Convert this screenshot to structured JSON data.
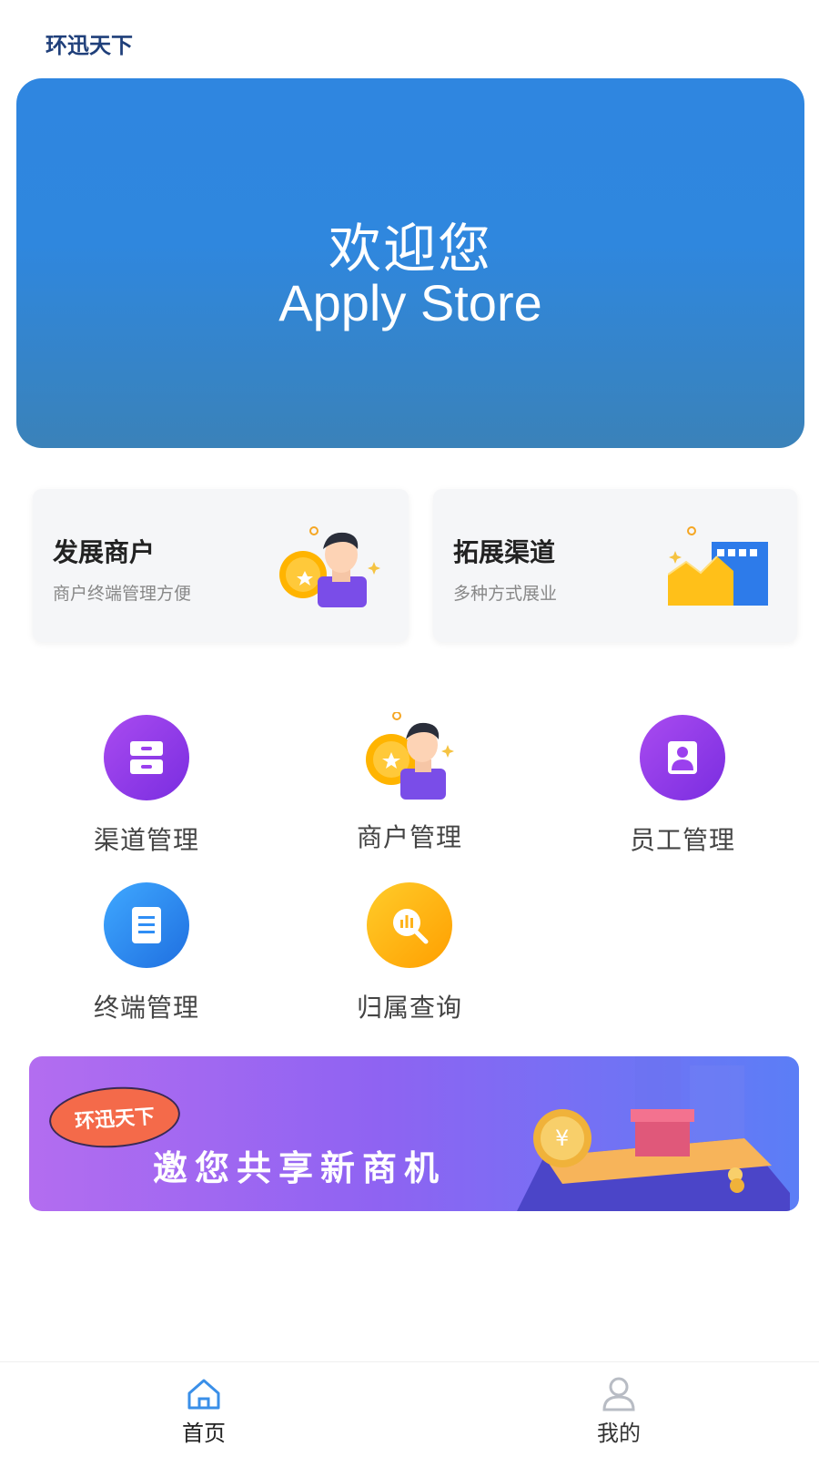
{
  "header": {
    "title": "环迅天下"
  },
  "hero": {
    "line1": "欢迎您",
    "line2": "Apply Store"
  },
  "cards": [
    {
      "title": "发展商户",
      "subtitle": "商户终端管理方便",
      "icon": "merchant-illustration-icon"
    },
    {
      "title": "拓展渠道",
      "subtitle": "多种方式展业",
      "icon": "channel-growth-illustration-icon"
    }
  ],
  "grid": [
    {
      "label": "渠道管理",
      "icon": "drawer-icon",
      "color": "#9b40ee"
    },
    {
      "label": "商户管理",
      "icon": "merchant-icon",
      "color": "#ffb31a"
    },
    {
      "label": "员工管理",
      "icon": "employee-icon",
      "color": "#9b40ee"
    },
    {
      "label": "终端管理",
      "icon": "document-icon",
      "color": "#2f8ef5"
    },
    {
      "label": "归属查询",
      "icon": "search-chart-icon",
      "color": "#ffb31a"
    }
  ],
  "promo": {
    "badge": "环迅天下",
    "text": "邀您共享新商机"
  },
  "tabbar": {
    "items": [
      {
        "label": "首页",
        "icon": "home-icon",
        "active": true
      },
      {
        "label": "我的",
        "icon": "user-icon",
        "active": false
      }
    ]
  }
}
